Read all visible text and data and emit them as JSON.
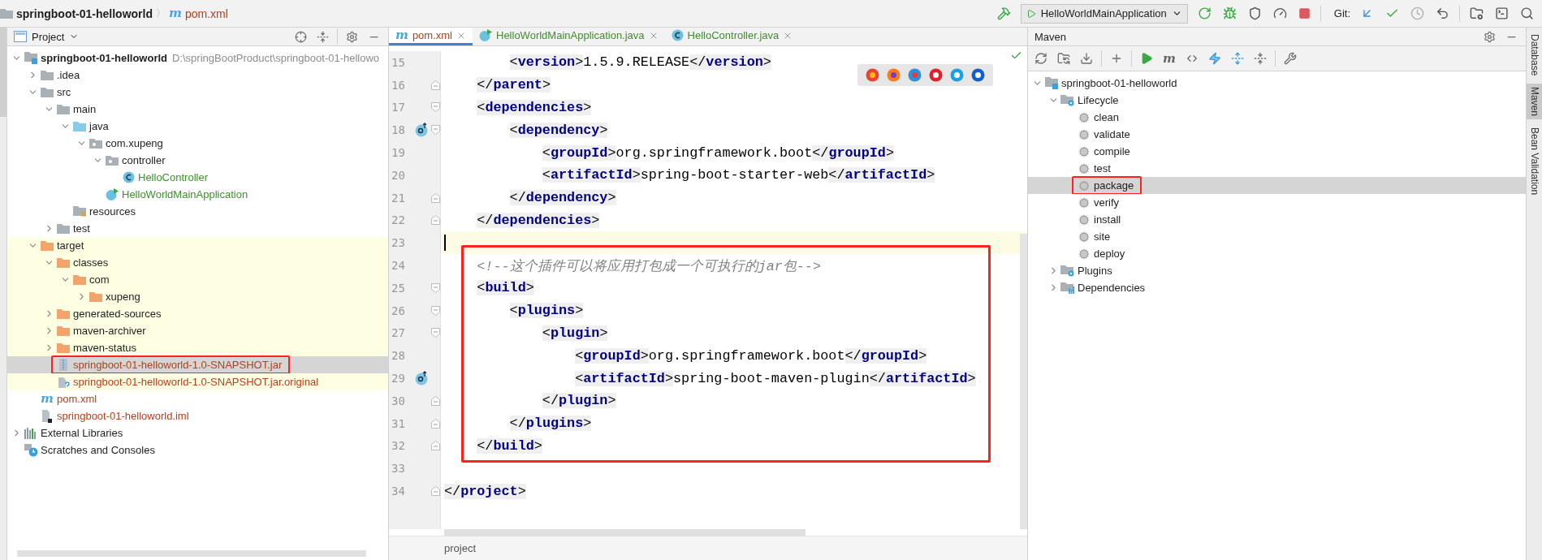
{
  "breadcrumb": {
    "project": "springboot-01-helloworld",
    "separator": "〉",
    "file": {
      "glyph": "m",
      "label": "pom.xml",
      "color": "#b0411c"
    }
  },
  "run_config": {
    "label": "HelloWorldMainApplication"
  },
  "git_label": "Git:",
  "project_panel": {
    "title": "Project",
    "tree": [
      {
        "label": "springboot-01-helloworld",
        "path": "D:\\springBootProduct\\springboot-01-hellowo",
        "kind": "module",
        "expanded": true,
        "selected": false,
        "boxed": false,
        "excluded": false,
        "children": [
          {
            "label": ".idea",
            "kind": "folder",
            "expanded": false,
            "selected": false,
            "boxed": false,
            "excluded": false
          },
          {
            "label": "src",
            "kind": "folder",
            "expanded": true,
            "selected": false,
            "boxed": false,
            "excluded": false,
            "children": [
              {
                "label": "main",
                "kind": "folder",
                "expanded": true,
                "selected": false,
                "boxed": false,
                "excluded": false,
                "children": [
                  {
                    "label": "java",
                    "kind": "source",
                    "expanded": true,
                    "selected": false,
                    "boxed": false,
                    "excluded": false,
                    "children": [
                      {
                        "label": "com.xupeng",
                        "kind": "package",
                        "expanded": true,
                        "selected": false,
                        "boxed": false,
                        "excluded": false,
                        "children": [
                          {
                            "label": "controller",
                            "kind": "package",
                            "expanded": true,
                            "selected": false,
                            "boxed": false,
                            "excluded": false,
                            "children": [
                              {
                                "label": "HelloController",
                                "kind": "class",
                                "color": "#3f8f2d",
                                "selected": false,
                                "boxed": false,
                                "excluded": false
                              }
                            ]
                          },
                          {
                            "label": "HelloWorldMainApplication",
                            "kind": "app",
                            "color": "#3f8f2d",
                            "selected": false,
                            "boxed": false,
                            "excluded": false
                          }
                        ]
                      }
                    ]
                  },
                  {
                    "label": "resources",
                    "kind": "resources",
                    "selected": false,
                    "boxed": false,
                    "excluded": false
                  }
                ]
              },
              {
                "label": "test",
                "kind": "folder",
                "expanded": false,
                "selected": false,
                "boxed": false,
                "excluded": false
              }
            ]
          },
          {
            "label": "target",
            "kind": "excluded",
            "expanded": true,
            "selected": false,
            "boxed": false,
            "excluded": true,
            "children": [
              {
                "label": "classes",
                "kind": "excluded",
                "expanded": true,
                "selected": false,
                "boxed": false,
                "excluded": true,
                "children": [
                  {
                    "label": "com",
                    "kind": "excluded",
                    "expanded": true,
                    "selected": false,
                    "boxed": false,
                    "excluded": true,
                    "children": [
                      {
                        "label": "xupeng",
                        "kind": "excluded",
                        "expanded": false,
                        "selected": false,
                        "boxed": false,
                        "excluded": true
                      }
                    ]
                  }
                ]
              },
              {
                "label": "generated-sources",
                "kind": "excluded",
                "expanded": false,
                "selected": false,
                "boxed": false,
                "excluded": true
              },
              {
                "label": "maven-archiver",
                "kind": "excluded",
                "expanded": false,
                "selected": false,
                "boxed": false,
                "excluded": true
              },
              {
                "label": "maven-status",
                "kind": "excluded",
                "expanded": false,
                "selected": false,
                "boxed": false,
                "excluded": true
              },
              {
                "label": "springboot-01-helloworld-1.0-SNAPSHOT.jar",
                "kind": "jar",
                "color": "#b0411c",
                "selected": true,
                "boxed": true,
                "excluded": true
              },
              {
                "label": "springboot-01-helloworld-1.0-SNAPSHOT.jar.original",
                "kind": "unknown",
                "color": "#b0411c",
                "selected": false,
                "boxed": false,
                "excluded": true
              }
            ]
          },
          {
            "label": "pom.xml",
            "kind": "maven",
            "glyph": "m",
            "color": "#b0411c",
            "selected": false,
            "boxed": false,
            "excluded": false
          },
          {
            "label": "springboot-01-helloworld.iml",
            "kind": "iml",
            "color": "#b0411c",
            "selected": false,
            "boxed": false,
            "excluded": false
          }
        ]
      },
      {
        "label": "External Libraries",
        "kind": "libraries",
        "expanded": false,
        "selected": false,
        "boxed": false,
        "excluded": false
      },
      {
        "label": "Scratches and Consoles",
        "kind": "scratches",
        "selected": false,
        "boxed": false,
        "excluded": false
      }
    ]
  },
  "tabs": [
    {
      "label": "pom.xml",
      "kind": "maven",
      "glyph": "m",
      "color": "#b0411c",
      "selected": true
    },
    {
      "label": "HelloWorldMainApplication.java",
      "kind": "app",
      "color": "#3f8f2d",
      "selected": false
    },
    {
      "label": "HelloController.java",
      "kind": "class",
      "color": "#3f8f2d",
      "selected": false
    }
  ],
  "editor": {
    "blocks": [
      {
        "boxed": false,
        "lines": [
          {
            "number": "15",
            "text": "        <version>1.5.9.RELEASE</version>",
            "fold_start": false,
            "fold_end": false,
            "current": false,
            "marker": false
          },
          {
            "number": "16",
            "text": "    </parent>",
            "fold_start": false,
            "fold_end": true,
            "current": false,
            "marker": false
          },
          {
            "number": "17",
            "text": "    <dependencies>",
            "fold_start": true,
            "fold_end": false,
            "current": false,
            "marker": false
          },
          {
            "number": "18",
            "text": "        <dependency>",
            "fold_start": true,
            "fold_end": false,
            "current": false,
            "marker": true
          },
          {
            "number": "19",
            "text": "            <groupId>org.springframework.boot</groupId>",
            "fold_start": false,
            "fold_end": false,
            "current": false,
            "marker": false
          },
          {
            "number": "20",
            "text": "            <artifactId>spring-boot-starter-web</artifactId>",
            "fold_start": false,
            "fold_end": false,
            "current": false,
            "marker": false
          },
          {
            "number": "21",
            "text": "        </dependency>",
            "fold_start": false,
            "fold_end": true,
            "current": false,
            "marker": false
          },
          {
            "number": "22",
            "text": "    </dependencies>",
            "fold_start": false,
            "fold_end": true,
            "current": false,
            "marker": false
          },
          {
            "number": "23",
            "fold_start": false,
            "fold_end": false,
            "current": true,
            "marker": false
          }
        ]
      },
      {
        "boxed": true,
        "lines": [
          {
            "number": "24",
            "text": "    <!--这个插件可以将应用打包成一个可执行的jar包-->",
            "fold_start": false,
            "fold_end": false,
            "current": false,
            "marker": false
          },
          {
            "number": "25",
            "text": "    <build>",
            "fold_start": true,
            "fold_end": false,
            "current": false,
            "marker": false
          },
          {
            "number": "26",
            "text": "        <plugins>",
            "fold_start": true,
            "fold_end": false,
            "current": false,
            "marker": false
          },
          {
            "number": "27",
            "text": "            <plugin>",
            "fold_start": true,
            "fold_end": false,
            "current": false,
            "marker": false
          },
          {
            "number": "28",
            "text": "                <groupId>org.springframework.boot</groupId>",
            "fold_start": false,
            "fold_end": false,
            "current": false,
            "marker": false
          },
          {
            "number": "29",
            "text": "                <artifactId>spring-boot-maven-plugin</artifactId>",
            "fold_start": false,
            "fold_end": false,
            "current": false,
            "marker": true
          },
          {
            "number": "30",
            "text": "            </plugin>",
            "fold_start": false,
            "fold_end": true,
            "current": false,
            "marker": false
          },
          {
            "number": "31",
            "text": "        </plugins>",
            "fold_start": false,
            "fold_end": true,
            "current": false,
            "marker": false
          },
          {
            "number": "32",
            "text": "    </build>",
            "fold_start": false,
            "fold_end": true,
            "current": false,
            "marker": false
          }
        ]
      },
      {
        "boxed": false,
        "lines": [
          {
            "number": "33",
            "fold_start": false,
            "fold_end": false,
            "current": false,
            "marker": false
          },
          {
            "number": "34",
            "text": "</project>",
            "fold_start": false,
            "fold_end": true,
            "current": false,
            "marker": false
          }
        ]
      }
    ],
    "breadcrumb": "project"
  },
  "maven_panel": {
    "title": "Maven",
    "toolbar_glyph": "m",
    "tree": [
      {
        "label": "springboot-01-helloworld",
        "kind": "module",
        "expanded": true,
        "selected": false,
        "boxed": false,
        "children": [
          {
            "label": "Lifecycle",
            "kind": "group",
            "expanded": true,
            "selected": false,
            "boxed": false,
            "children": [
              {
                "label": "clean",
                "kind": "goal",
                "selected": false,
                "boxed": false
              },
              {
                "label": "validate",
                "kind": "goal",
                "selected": false,
                "boxed": false
              },
              {
                "label": "compile",
                "kind": "goal",
                "selected": false,
                "boxed": false
              },
              {
                "label": "test",
                "kind": "goal",
                "selected": false,
                "boxed": false
              },
              {
                "label": "package",
                "kind": "goal",
                "selected": true,
                "boxed": true
              },
              {
                "label": "verify",
                "kind": "goal",
                "selected": false,
                "boxed": false
              },
              {
                "label": "install",
                "kind": "goal",
                "selected": false,
                "boxed": false
              },
              {
                "label": "site",
                "kind": "goal",
                "selected": false,
                "boxed": false
              },
              {
                "label": "deploy",
                "kind": "goal",
                "selected": false,
                "boxed": false
              }
            ]
          },
          {
            "label": "Plugins",
            "kind": "group",
            "expanded": false,
            "selected": false,
            "boxed": false
          },
          {
            "label": "Dependencies",
            "kind": "deps",
            "expanded": false,
            "selected": false,
            "boxed": false
          }
        ]
      }
    ]
  },
  "right_tool_tabs": [
    {
      "label": "Database",
      "selected": false
    },
    {
      "label": "Maven",
      "selected": true
    },
    {
      "label": "Bean Validation",
      "selected": false
    }
  ]
}
